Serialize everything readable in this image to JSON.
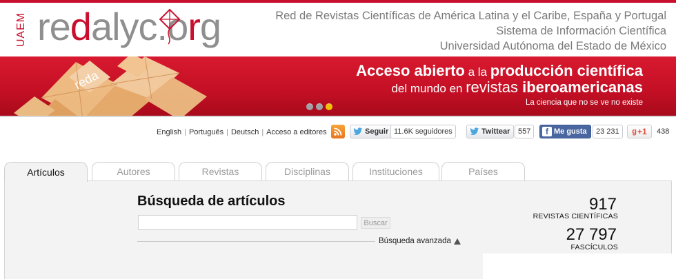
{
  "header": {
    "uaem": "UAEM",
    "logo_parts": [
      "re",
      "d",
      "alyc.o",
      "r",
      "g"
    ],
    "lines": [
      "Red de Revistas Científicas de América Latina y el Caribe, España y Portugal",
      "Sistema de Información Científica",
      "Universidad Autónoma del Estado de México"
    ]
  },
  "banner": {
    "line1_bold_a": "Acceso abierto",
    "line1_light": " a la ",
    "line1_bold_b": "producción científica",
    "line2_light": "del mundo en ",
    "line2_mid": "revistas ",
    "line2_bold": "iberoamericanas",
    "tagline": "La ciencia que no se ve no existe",
    "art_text": "reda",
    "slides": 3,
    "active_slide": 3
  },
  "languages": [
    "English",
    "Português",
    "Deutsch",
    "Acceso a editores"
  ],
  "social": {
    "follow_label": "Seguir",
    "follow_count": "11.6K seguidores",
    "tweet_label": "Twittear",
    "tweet_count": "557",
    "like_label": "Me gusta",
    "like_count": "23 231",
    "gplus_label": "+1",
    "gplus_count": "438"
  },
  "tabs": [
    "Artículos",
    "Autores",
    "Revistas",
    "Disciplinas",
    "Instituciones",
    "Países"
  ],
  "active_tab": "Artículos",
  "search": {
    "title": "Búsqueda de artículos",
    "input_value": "",
    "input_placeholder": "",
    "button_label": "Buscar",
    "advanced_label": "Búsqueda avanzada"
  },
  "stats": [
    {
      "value": "917",
      "label": "REVISTAS CIENTÍFICAS"
    },
    {
      "value": "27 797",
      "label": "FASCÍCULOS"
    }
  ],
  "colors": {
    "brand_red": "#c8102e",
    "grey_text": "#7a7a7a",
    "facebook": "#4a66a0",
    "twitter": "#4da7de",
    "rss": "#ee8a24",
    "dot_active": "#f0c000"
  }
}
